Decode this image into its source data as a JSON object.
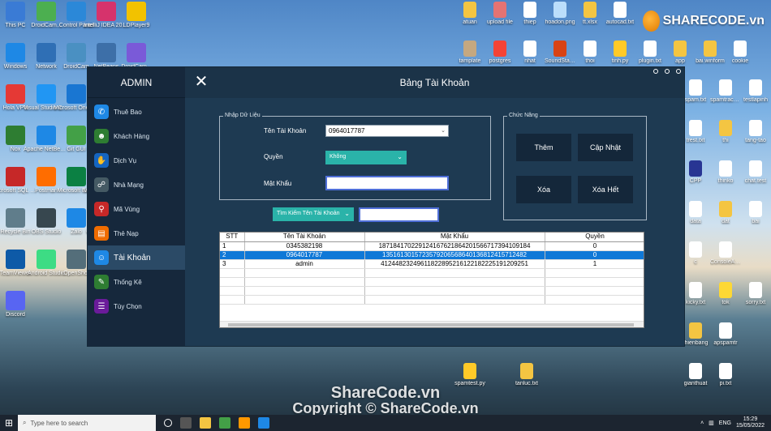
{
  "desktop": {
    "left_icons": [
      {
        "label": "This PC",
        "color": "#3a7bd5"
      },
      {
        "label": "DroidCam...",
        "color": "#4caf50"
      },
      {
        "label": "Control Panel",
        "color": "#2b88d8"
      },
      {
        "label": "IntelliJ IDEA 2021.3",
        "color": "#d6336c"
      },
      {
        "label": "LDPlayer9",
        "color": "#f2c200"
      },
      {
        "label": "Windows",
        "color": "#1e88e5"
      },
      {
        "label": "Network",
        "color": "#2f6fb5"
      },
      {
        "label": "DroidCam",
        "color": "#4a90c2"
      },
      {
        "label": "NetBeans",
        "color": "#3d6fa8"
      },
      {
        "label": "DroidCam...",
        "color": "#7a5ad8"
      },
      {
        "label": "Hola VPN",
        "color": "#e53935"
      },
      {
        "label": "Visual Studio Code",
        "color": "#2196f3"
      },
      {
        "label": "Microsoft OneDrive",
        "color": "#1976d2"
      },
      {
        "label": "TeamViewer",
        "color": "#1565c0"
      },
      {
        "label": "Git Bash",
        "color": "#e64a19"
      },
      {
        "label": "Nox",
        "color": "#2e7d32"
      },
      {
        "label": "Apache NetBeans",
        "color": "#1e88e5"
      },
      {
        "label": "Git GUI",
        "color": "#43a047"
      },
      {
        "label": "Dev-C++",
        "color": "#3949ab"
      },
      {
        "label": "Sublime Text",
        "color": "#ff7043"
      },
      {
        "label": "Microsoft SQL Server",
        "color": "#c62828"
      },
      {
        "label": "Postman",
        "color": "#ff6d00"
      },
      {
        "label": "Microsoft Edge",
        "color": "#0b8043"
      },
      {
        "label": "VMware Workstation",
        "color": "#5d6d7e"
      },
      {
        "label": "Advanced IP Scanner",
        "color": "#e65100"
      },
      {
        "label": "Recycle Bin",
        "color": "#607d8b"
      },
      {
        "label": "OBS Studio",
        "color": "#37474f"
      },
      {
        "label": "Zalo",
        "color": "#1e88e5"
      },
      {
        "label": "Google Chrome",
        "color": "#e53935"
      },
      {
        "label": "Adobe Photoshop",
        "color": "#1a3a6e"
      },
      {
        "label": "TeamViewer",
        "color": "#0e5aa7"
      },
      {
        "label": "Android Studio",
        "color": "#3ddc84"
      },
      {
        "label": "OpenShot",
        "color": "#546e7a"
      },
      {
        "label": "Unikey",
        "color": "#c62828"
      },
      {
        "label": "CMD",
        "color": "#263238"
      },
      {
        "label": "Discord",
        "color": "#5865f2"
      }
    ],
    "right_icons": [
      {
        "label": "atuan",
        "color": "#f4c542"
      },
      {
        "label": "upload file",
        "color": "#e57373"
      },
      {
        "label": "thiep",
        "color": "#ffffff"
      },
      {
        "label": "hoadon.png",
        "color": "#bbdefb"
      },
      {
        "label": "tt.xlsx",
        "color": "#f4c542"
      },
      {
        "label": "autocad.txt",
        "color": "#ffffff"
      },
      {
        "label": "tamplate",
        "color": "#c5a880"
      },
      {
        "label": "postgres",
        "color": "#f44336"
      },
      {
        "label": "nhat",
        "color": "#ffffff"
      },
      {
        "label": "SoundStation",
        "color": "#d84315"
      },
      {
        "label": "thoi",
        "color": "#ffffff"
      },
      {
        "label": "tinh.py",
        "color": "#ffca28"
      },
      {
        "label": "plugin.txt",
        "color": "#ffffff"
      },
      {
        "label": "app",
        "color": "#f4c542"
      },
      {
        "label": "bai.winform",
        "color": "#f4c542"
      },
      {
        "label": "cookie",
        "color": "#ffffff"
      },
      {
        "label": "spam.txt",
        "color": "#ffffff"
      },
      {
        "label": "spamtracker",
        "color": "#ffffff"
      },
      {
        "label": "testlapinh",
        "color": "#ffffff"
      },
      {
        "label": "trest.txt",
        "color": "#ffffff"
      },
      {
        "label": "thi",
        "color": "#f4c542"
      },
      {
        "label": "tang-tao",
        "color": "#ffffff"
      },
      {
        "label": "CPP",
        "color": "#283593"
      },
      {
        "label": "thinko",
        "color": "#ffffff"
      },
      {
        "label": "chat.test",
        "color": "#ffffff"
      },
      {
        "label": "data",
        "color": "#ffffff"
      },
      {
        "label": "dat",
        "color": "#f4c542"
      },
      {
        "label": "bai",
        "color": "#ffffff"
      },
      {
        "label": "c",
        "color": "#ffffff"
      },
      {
        "label": "ConsoleApp",
        "color": "#ffffff"
      },
      {
        "label": "kicky.txt",
        "color": "#ffffff"
      },
      {
        "label": "tok",
        "color": "#fdd835"
      },
      {
        "label": "sorry.txt",
        "color": "#ffffff"
      },
      {
        "label": "thienbang",
        "color": "#f4c542"
      },
      {
        "label": "apspamtr",
        "color": "#ffffff"
      },
      {
        "label": "cleanup",
        "color": "#f4c542"
      },
      {
        "label": "tanluc.txt",
        "color": "#f4c542"
      },
      {
        "label": "spamtest.py",
        "color": "#ffca28"
      },
      {
        "label": "gianthuat",
        "color": "#ffffff"
      },
      {
        "label": "pi.txt",
        "color": "#ffffff"
      }
    ],
    "logo_text": "SHARECODE.vn",
    "watermark_1": "ShareCode.vn",
    "watermark_2": "Copyright © ShareCode.vn"
  },
  "app": {
    "sidebar_title": "ADMIN",
    "window_title": "Bảng Tài Khoản",
    "sidebar_items": [
      {
        "label": "Thuê Bao",
        "icon": "phone-icon",
        "color": "#1e88e5",
        "glyph": "✆"
      },
      {
        "label": "Khách Hàng",
        "icon": "users-icon",
        "color": "#2e7d32",
        "glyph": "☻"
      },
      {
        "label": "Dịch Vụ",
        "icon": "hand-icon",
        "color": "#1565c0",
        "glyph": "✋"
      },
      {
        "label": "Nhà Mạng",
        "icon": "network-icon",
        "color": "#455a64",
        "glyph": "☍"
      },
      {
        "label": "Mã Vùng",
        "icon": "map-pin-icon",
        "color": "#c62828",
        "glyph": "⚲"
      },
      {
        "label": "Thẻ Nạp",
        "icon": "card-icon",
        "color": "#ef6c00",
        "glyph": "▤"
      },
      {
        "label": "Tài Khoản",
        "icon": "account-icon",
        "color": "#1e88e5",
        "glyph": "☺"
      },
      {
        "label": "Thống Kê",
        "icon": "chart-icon",
        "color": "#2e7d32",
        "glyph": "✎"
      },
      {
        "label": "Tùy Chọn",
        "icon": "options-icon",
        "color": "#6a1b9a",
        "glyph": "☰"
      }
    ],
    "active_item": 6,
    "input_group_legend": "Nhập Dữ Liệu",
    "account_label": "Tên Tài Khoản",
    "account_value": "0964017787",
    "role_label": "Quyền",
    "role_value": "Không",
    "password_label": "Mật Khẩu",
    "password_value": "",
    "action_group_legend": "Chức Năng",
    "btn_add": "Thêm",
    "btn_update": "Cập Nhật",
    "btn_delete": "Xóa",
    "btn_delete_all": "Xóa Hết",
    "search_combo_label": "Tìm Kiếm Tên Tài Khoản",
    "search_value": "",
    "table_headers": [
      "STT",
      "Tên Tài Khoản",
      "Mật Khẩu",
      "Quyền"
    ],
    "table_rows": [
      [
        "1",
        "0345382198",
        "18718417022912416762186420156671739410918​4",
        "0"
      ],
      [
        "2",
        "0964017787",
        "1351613015723579206568640136812415712482",
        "0"
      ],
      [
        "3",
        "admin",
        "41244823249611822895216122182225191209251",
        "1"
      ]
    ],
    "selected_row": 1
  },
  "taskbar": {
    "search_placeholder": "Type here to search",
    "language": "ENG",
    "time": "15:29",
    "date": "15/05/2022"
  }
}
